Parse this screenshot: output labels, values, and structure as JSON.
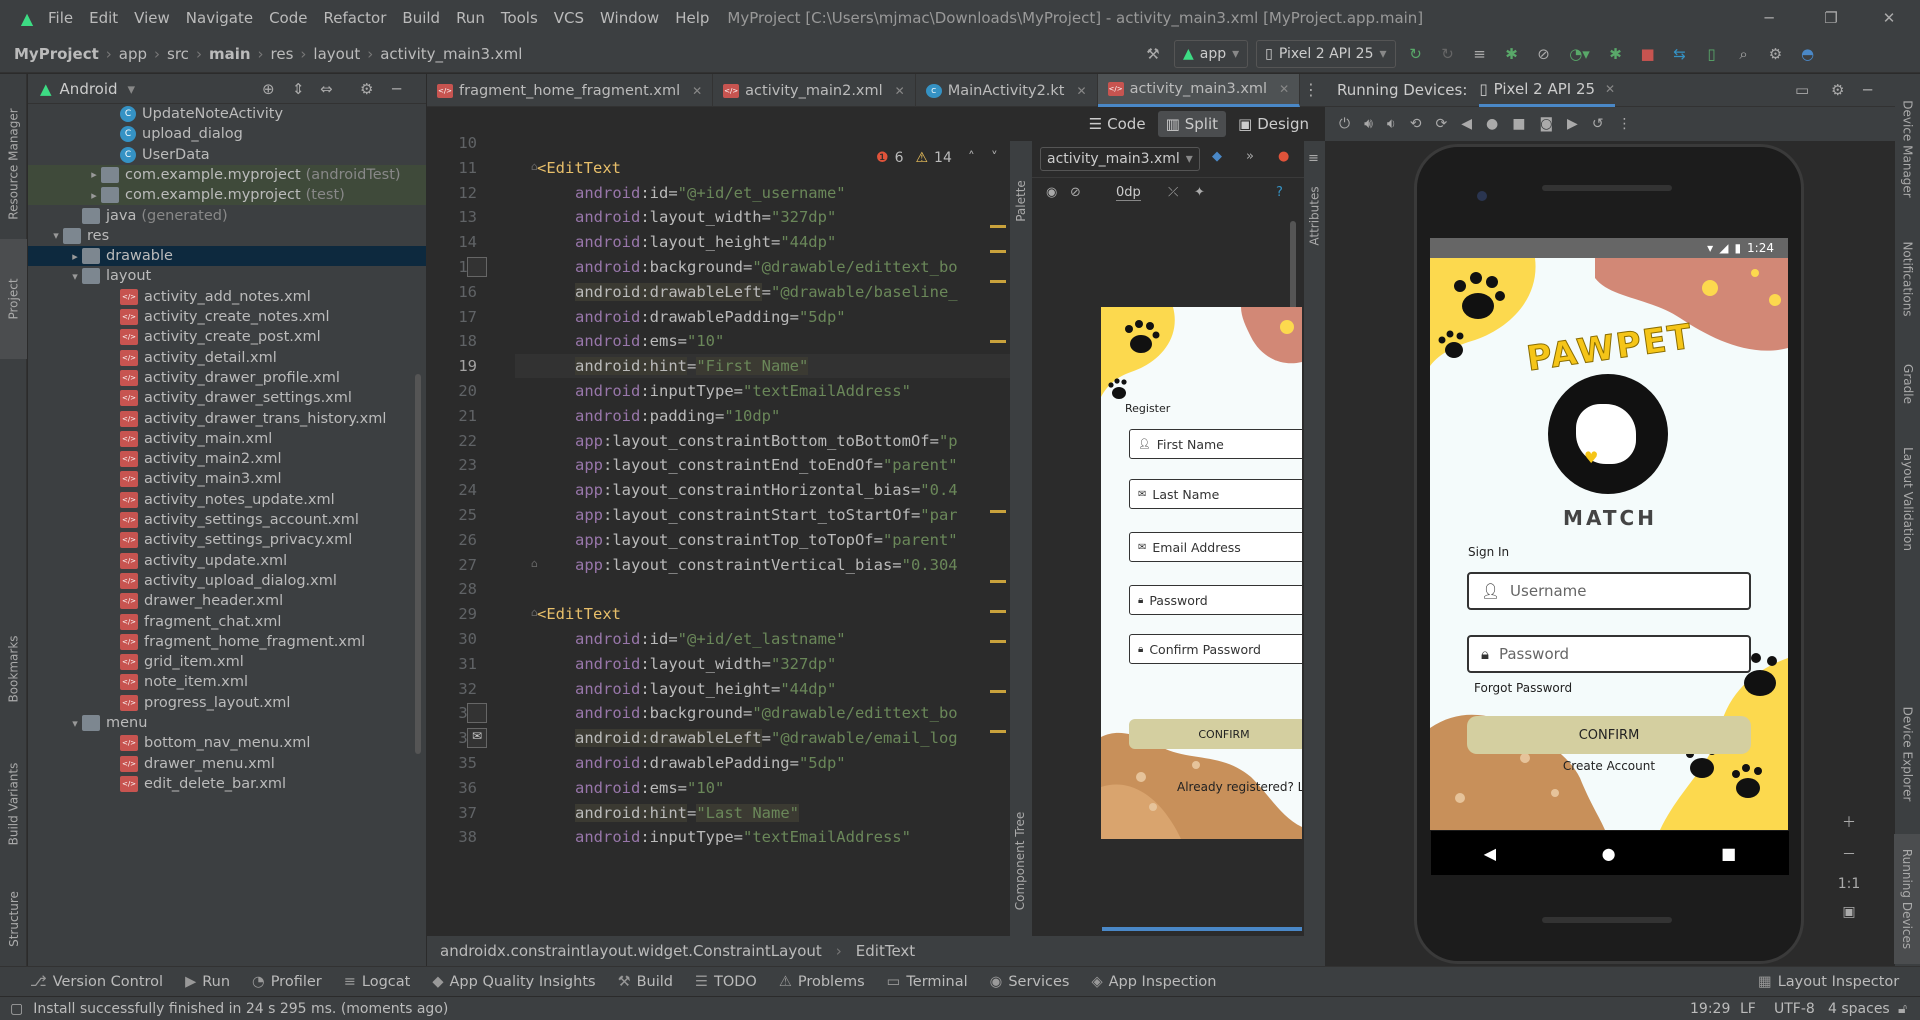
{
  "menu": {
    "items": [
      "File",
      "Edit",
      "View",
      "Navigate",
      "Code",
      "Refactor",
      "Build",
      "Run",
      "Tools",
      "VCS",
      "Window",
      "Help"
    ],
    "title": "MyProject [C:\\Users\\mjmac\\Downloads\\MyProject] - activity_main3.xml [MyProject.app.main]"
  },
  "nav": {
    "crumbs": [
      "MyProject",
      "app",
      "src",
      "main",
      "res",
      "layout",
      "activity_main3.xml"
    ],
    "run_config": "app",
    "device": "Pixel 2 API 25"
  },
  "project": {
    "view_mode": "Android",
    "rows": [
      {
        "label": "UpdateNoteActivity",
        "icon": "kt",
        "indent": 4
      },
      {
        "label": "upload_dialog",
        "icon": "kt",
        "indent": 4
      },
      {
        "label": "UserData",
        "icon": "kt",
        "indent": 4
      },
      {
        "label": "com.example.myproject",
        "suffix": "(androidTest)",
        "icon": "folder",
        "indent": 3,
        "arrow": "▸"
      },
      {
        "label": "com.example.myproject",
        "suffix": "(test)",
        "icon": "folder",
        "indent": 3,
        "arrow": "▸"
      },
      {
        "label": "java",
        "suffix": "(generated)",
        "icon": "folder",
        "indent": 2
      },
      {
        "label": "res",
        "icon": "folder",
        "indent": 1,
        "arrow": "▾"
      },
      {
        "label": "drawable",
        "icon": "folder",
        "indent": 2,
        "arrow": "▸",
        "selected": true
      },
      {
        "label": "layout",
        "icon": "folder",
        "indent": 2,
        "arrow": "▾"
      },
      {
        "label": "activity_add_notes.xml",
        "icon": "xml",
        "indent": 4
      },
      {
        "label": "activity_create_notes.xml",
        "icon": "xml",
        "indent": 4
      },
      {
        "label": "activity_create_post.xml",
        "icon": "xml",
        "indent": 4
      },
      {
        "label": "activity_detail.xml",
        "icon": "xml",
        "indent": 4
      },
      {
        "label": "activity_drawer_profile.xml",
        "icon": "xml",
        "indent": 4
      },
      {
        "label": "activity_drawer_settings.xml",
        "icon": "xml",
        "indent": 4
      },
      {
        "label": "activity_drawer_trans_history.xml",
        "icon": "xml",
        "indent": 4
      },
      {
        "label": "activity_main.xml",
        "icon": "xml",
        "indent": 4
      },
      {
        "label": "activity_main2.xml",
        "icon": "xml",
        "indent": 4
      },
      {
        "label": "activity_main3.xml",
        "icon": "xml",
        "indent": 4
      },
      {
        "label": "activity_notes_update.xml",
        "icon": "xml",
        "indent": 4
      },
      {
        "label": "activity_settings_account.xml",
        "icon": "xml",
        "indent": 4
      },
      {
        "label": "activity_settings_privacy.xml",
        "icon": "xml",
        "indent": 4
      },
      {
        "label": "activity_update.xml",
        "icon": "xml",
        "indent": 4
      },
      {
        "label": "activity_upload_dialog.xml",
        "icon": "xml",
        "indent": 4
      },
      {
        "label": "drawer_header.xml",
        "icon": "xml",
        "indent": 4
      },
      {
        "label": "fragment_chat.xml",
        "icon": "xml",
        "indent": 4
      },
      {
        "label": "fragment_home_fragment.xml",
        "icon": "xml",
        "indent": 4
      },
      {
        "label": "grid_item.xml",
        "icon": "xml",
        "indent": 4
      },
      {
        "label": "note_item.xml",
        "icon": "xml",
        "indent": 4
      },
      {
        "label": "progress_layout.xml",
        "icon": "xml",
        "indent": 4
      },
      {
        "label": "menu",
        "icon": "folder",
        "indent": 2,
        "arrow": "▾"
      },
      {
        "label": "bottom_nav_menu.xml",
        "icon": "xml",
        "indent": 4
      },
      {
        "label": "drawer_menu.xml",
        "icon": "xml",
        "indent": 4
      },
      {
        "label": "edit_delete_bar.xml",
        "icon": "xml",
        "indent": 4
      }
    ]
  },
  "left_strip": [
    "Resource Manager",
    "Project",
    "Bookmarks",
    "Build Variants",
    "Structure"
  ],
  "right_strip": [
    "Device Manager",
    "Notifications",
    "Gradle",
    "Layout Validation",
    "Device Explorer",
    "Running Devices"
  ],
  "tabs": [
    {
      "label": "fragment_home_fragment.xml",
      "icon": "xml"
    },
    {
      "label": "activity_main2.xml",
      "icon": "xml"
    },
    {
      "label": "MainActivity2.kt",
      "icon": "kt"
    },
    {
      "label": "activity_main3.xml",
      "icon": "xml",
      "active": true
    }
  ],
  "view_modes": [
    "Code",
    "Split",
    "Design"
  ],
  "warnings": {
    "errors": "6",
    "warnings": "14"
  },
  "code": [
    {
      "n": "10",
      "parts": []
    },
    {
      "n": "11",
      "parts": [
        [
          "tag",
          "<EditText"
        ]
      ],
      "indent": 1
    },
    {
      "n": "12",
      "parts": [
        [
          "ns",
          "android"
        ],
        [
          "attr",
          ":id="
        ],
        [
          "str",
          "\"@+id/et_username\""
        ]
      ],
      "indent": 2
    },
    {
      "n": "13",
      "parts": [
        [
          "ns",
          "android"
        ],
        [
          "attr",
          ":layout_width="
        ],
        [
          "str",
          "\"327dp\""
        ]
      ],
      "indent": 2
    },
    {
      "n": "14",
      "parts": [
        [
          "ns",
          "android"
        ],
        [
          "attr",
          ":layout_height="
        ],
        [
          "str",
          "\"44dp\""
        ]
      ],
      "indent": 2
    },
    {
      "n": "15",
      "parts": [
        [
          "ns",
          "android"
        ],
        [
          "attr",
          ":background="
        ],
        [
          "str",
          "\"@drawable/edittext_bo"
        ]
      ],
      "indent": 2
    },
    {
      "n": "16",
      "parts": [
        [
          "hl",
          "android:drawableLeft"
        ],
        [
          "attr",
          "="
        ],
        [
          "str",
          "\"@drawable/baseline_"
        ]
      ],
      "indent": 2
    },
    {
      "n": "17",
      "parts": [
        [
          "ns",
          "android"
        ],
        [
          "attr",
          ":drawablePadding="
        ],
        [
          "str",
          "\"5dp\""
        ]
      ],
      "indent": 2
    },
    {
      "n": "18",
      "parts": [
        [
          "ns",
          "android"
        ],
        [
          "attr",
          ":ems="
        ],
        [
          "str",
          "\"10\""
        ]
      ],
      "indent": 2
    },
    {
      "n": "19",
      "parts": [
        [
          "hl",
          "android:hint"
        ],
        [
          "attr",
          "="
        ],
        [
          "strhl",
          "\"First Name\""
        ]
      ],
      "indent": 2,
      "current": true
    },
    {
      "n": "20",
      "parts": [
        [
          "ns",
          "android"
        ],
        [
          "attr",
          ":inputType="
        ],
        [
          "str",
          "\"textEmailAddress\""
        ]
      ],
      "indent": 2
    },
    {
      "n": "21",
      "parts": [
        [
          "ns",
          "android"
        ],
        [
          "attr",
          ":padding="
        ],
        [
          "str",
          "\"10dp\""
        ]
      ],
      "indent": 2
    },
    {
      "n": "22",
      "parts": [
        [
          "ns",
          "app"
        ],
        [
          "attr",
          ":layout_constraintBottom_toBottomOf="
        ],
        [
          "str",
          "\"p"
        ]
      ],
      "indent": 2
    },
    {
      "n": "23",
      "parts": [
        [
          "ns",
          "app"
        ],
        [
          "attr",
          ":layout_constraintEnd_toEndOf="
        ],
        [
          "str",
          "\"parent\""
        ]
      ],
      "indent": 2
    },
    {
      "n": "24",
      "parts": [
        [
          "ns",
          "app"
        ],
        [
          "attr",
          ":layout_constraintHorizontal_bias="
        ],
        [
          "str",
          "\"0.4"
        ]
      ],
      "indent": 2
    },
    {
      "n": "25",
      "parts": [
        [
          "ns",
          "app"
        ],
        [
          "attr",
          ":layout_constraintStart_toStartOf="
        ],
        [
          "str",
          "\"par"
        ]
      ],
      "indent": 2
    },
    {
      "n": "26",
      "parts": [
        [
          "ns",
          "app"
        ],
        [
          "attr",
          ":layout_constraintTop_toTopOf="
        ],
        [
          "str",
          "\"parent\""
        ]
      ],
      "indent": 2
    },
    {
      "n": "27",
      "parts": [
        [
          "ns",
          "app"
        ],
        [
          "attr",
          ":layout_constraintVertical_bias="
        ],
        [
          "str",
          "\"0.304"
        ]
      ],
      "indent": 2
    },
    {
      "n": "28",
      "parts": []
    },
    {
      "n": "29",
      "parts": [
        [
          "tag",
          "<EditText"
        ]
      ],
      "indent": 1
    },
    {
      "n": "30",
      "parts": [
        [
          "ns",
          "android"
        ],
        [
          "attr",
          ":id="
        ],
        [
          "str",
          "\"@+id/et_lastname\""
        ]
      ],
      "indent": 2
    },
    {
      "n": "31",
      "parts": [
        [
          "ns",
          "android"
        ],
        [
          "attr",
          ":layout_width="
        ],
        [
          "str",
          "\"327dp\""
        ]
      ],
      "indent": 2
    },
    {
      "n": "32",
      "parts": [
        [
          "ns",
          "android"
        ],
        [
          "attr",
          ":layout_height="
        ],
        [
          "str",
          "\"44dp\""
        ]
      ],
      "indent": 2
    },
    {
      "n": "33",
      "parts": [
        [
          "ns",
          "android"
        ],
        [
          "attr",
          ":background="
        ],
        [
          "str",
          "\"@drawable/edittext_bo"
        ]
      ],
      "indent": 2
    },
    {
      "n": "34",
      "parts": [
        [
          "hl",
          "android:drawableLeft"
        ],
        [
          "attr",
          "="
        ],
        [
          "str",
          "\"@drawable/email_log"
        ]
      ],
      "indent": 2
    },
    {
      "n": "35",
      "parts": [
        [
          "ns",
          "android"
        ],
        [
          "attr",
          ":drawablePadding="
        ],
        [
          "str",
          "\"5dp\""
        ]
      ],
      "indent": 2
    },
    {
      "n": "36",
      "parts": [
        [
          "ns",
          "android"
        ],
        [
          "attr",
          ":ems="
        ],
        [
          "str",
          "\"10\""
        ]
      ],
      "indent": 2
    },
    {
      "n": "37",
      "parts": [
        [
          "hl",
          "android:hint"
        ],
        [
          "attr",
          "="
        ],
        [
          "strhl",
          "\"Last Name\""
        ]
      ],
      "indent": 2
    },
    {
      "n": "38",
      "parts": [
        [
          "ns",
          "android"
        ],
        [
          "attr",
          ":inputType="
        ],
        [
          "str",
          "\"textEmailAddress\""
        ]
      ],
      "indent": 2
    }
  ],
  "design": {
    "file": "activity_main3.xml",
    "margin": "0dp",
    "palette_label": "Palette",
    "component_tree_label": "Component Tree",
    "attributes_label": "Attributes",
    "preview": {
      "title": "Register",
      "fields": [
        "First Name",
        "Last Name",
        "Email Address",
        "Password",
        "Confirm Password"
      ],
      "confirm": "CONFIRM",
      "footer": "Already registered? Lo"
    }
  },
  "breadcrumb2": [
    "androidx.constraintlayout.widget.ConstraintLayout",
    "EditText"
  ],
  "running": {
    "label": "Running Devices:",
    "tab": "Pixel 2 API 25",
    "time": "1:24",
    "logo_top": "PAWPET",
    "logo_bottom": "MATCH",
    "sign_in": "Sign In",
    "username_ph": "Username",
    "password_ph": "Password",
    "forgot": "Forgot Password",
    "confirm": "CONFIRM",
    "create": "Create Account",
    "zoom_label": "1:1"
  },
  "bottom_tools": [
    "Version Control",
    "Run",
    "Profiler",
    "Logcat",
    "App Quality Insights",
    "Build",
    "TODO",
    "Problems",
    "Terminal",
    "Services",
    "App Inspection"
  ],
  "layout_inspector": "Layout Inspector",
  "status": {
    "message": "Install successfully finished in 24 s 295 ms. (moments ago)",
    "position": "19:29",
    "line_sep": "LF",
    "encoding": "UTF-8",
    "indent": "4 spaces"
  },
  "colors": {
    "accent": "#4a88c7",
    "android_green": "#3ddc84",
    "error": "#e0533a",
    "warning": "#f2c55c",
    "paw_yellow": "#fcd94e",
    "blob_brown": "#c8905a",
    "blob_pink": "#d28876",
    "confirm_btn": "#d4cfa0"
  }
}
